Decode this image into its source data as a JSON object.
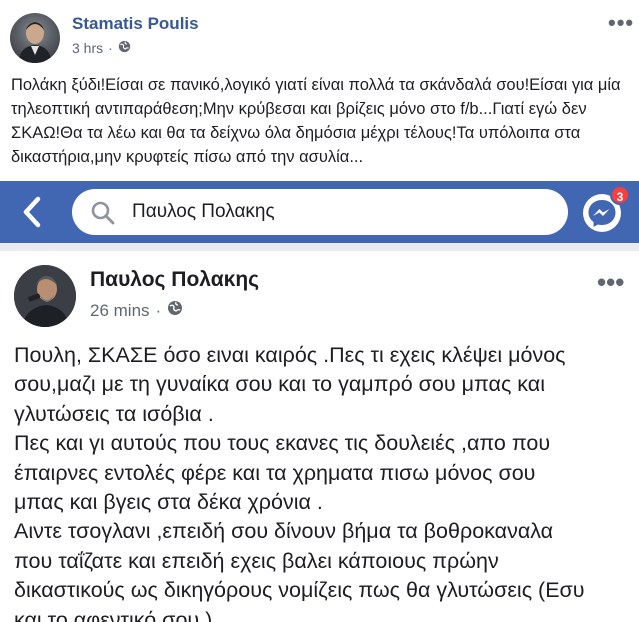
{
  "outer_post": {
    "author": "Stamatis Poulis",
    "time": "3 hrs",
    "privacy_sep": "·",
    "more_label": "•••",
    "text": "Πολάκη ξύδι!Είσαι σε πανικό,λογικό γιατί είναι πολλά τα σκάνδαλά σου!Είσαι για μία τηλεοπτική αντιπαράθεση;Μην κρύβεσαι και βρίζεις μόνο στο f/b...Γιατί εγώ δεν ΣΚΑΩ!Θα τα λέω και θα τα δείχνω όλα δημόσια μέχρι τέλους!Τα υπόλοιπα στα δικαστήρια,μην κρυφτείς πίσω από την ασυλία..."
  },
  "embedded": {
    "search": {
      "value": "Παυλος Πολακης"
    },
    "messenger_badge": "3",
    "post": {
      "author": "Παυλος Πολακης",
      "time": "26 mins",
      "privacy_sep": "·",
      "more_label": "•••",
      "lines": [
        "Πουλη, ΣΚΑΣΕ  όσο ειναι καιρός .Πες τι εχεις κλέψει μόνος",
        "σου,μαζι με τη γυναίκα σου και το γαμπρό σου μπας και",
        "γλυτώσεις τα ισόβια .",
        "Πες και γι αυτούς που τους εκανες τις δουλειές ,απο που",
        "έπαιρνες εντολές φέρε και τα χρηματα πισω μόνος σου",
        "μπας και βγεις στα δέκα χρόνια .",
        "Αιντε τσογλανι ,επειδή σου δίνουν βήμα τα βοθροκαναλα",
        "που ταΐζατε και επειδή εχεις βαλει κάποιους πρώην",
        "δικαστικούς ως δικηγόρους νομίζεις πως θα γλυτώσεις (Εσυ",
        "και το αφεντικό σου )"
      ]
    }
  },
  "colors": {
    "facebook_blue": "#4267b2",
    "link_blue": "#385898",
    "badge_red": "#fa3e3e",
    "meta_gray": "#606770"
  }
}
